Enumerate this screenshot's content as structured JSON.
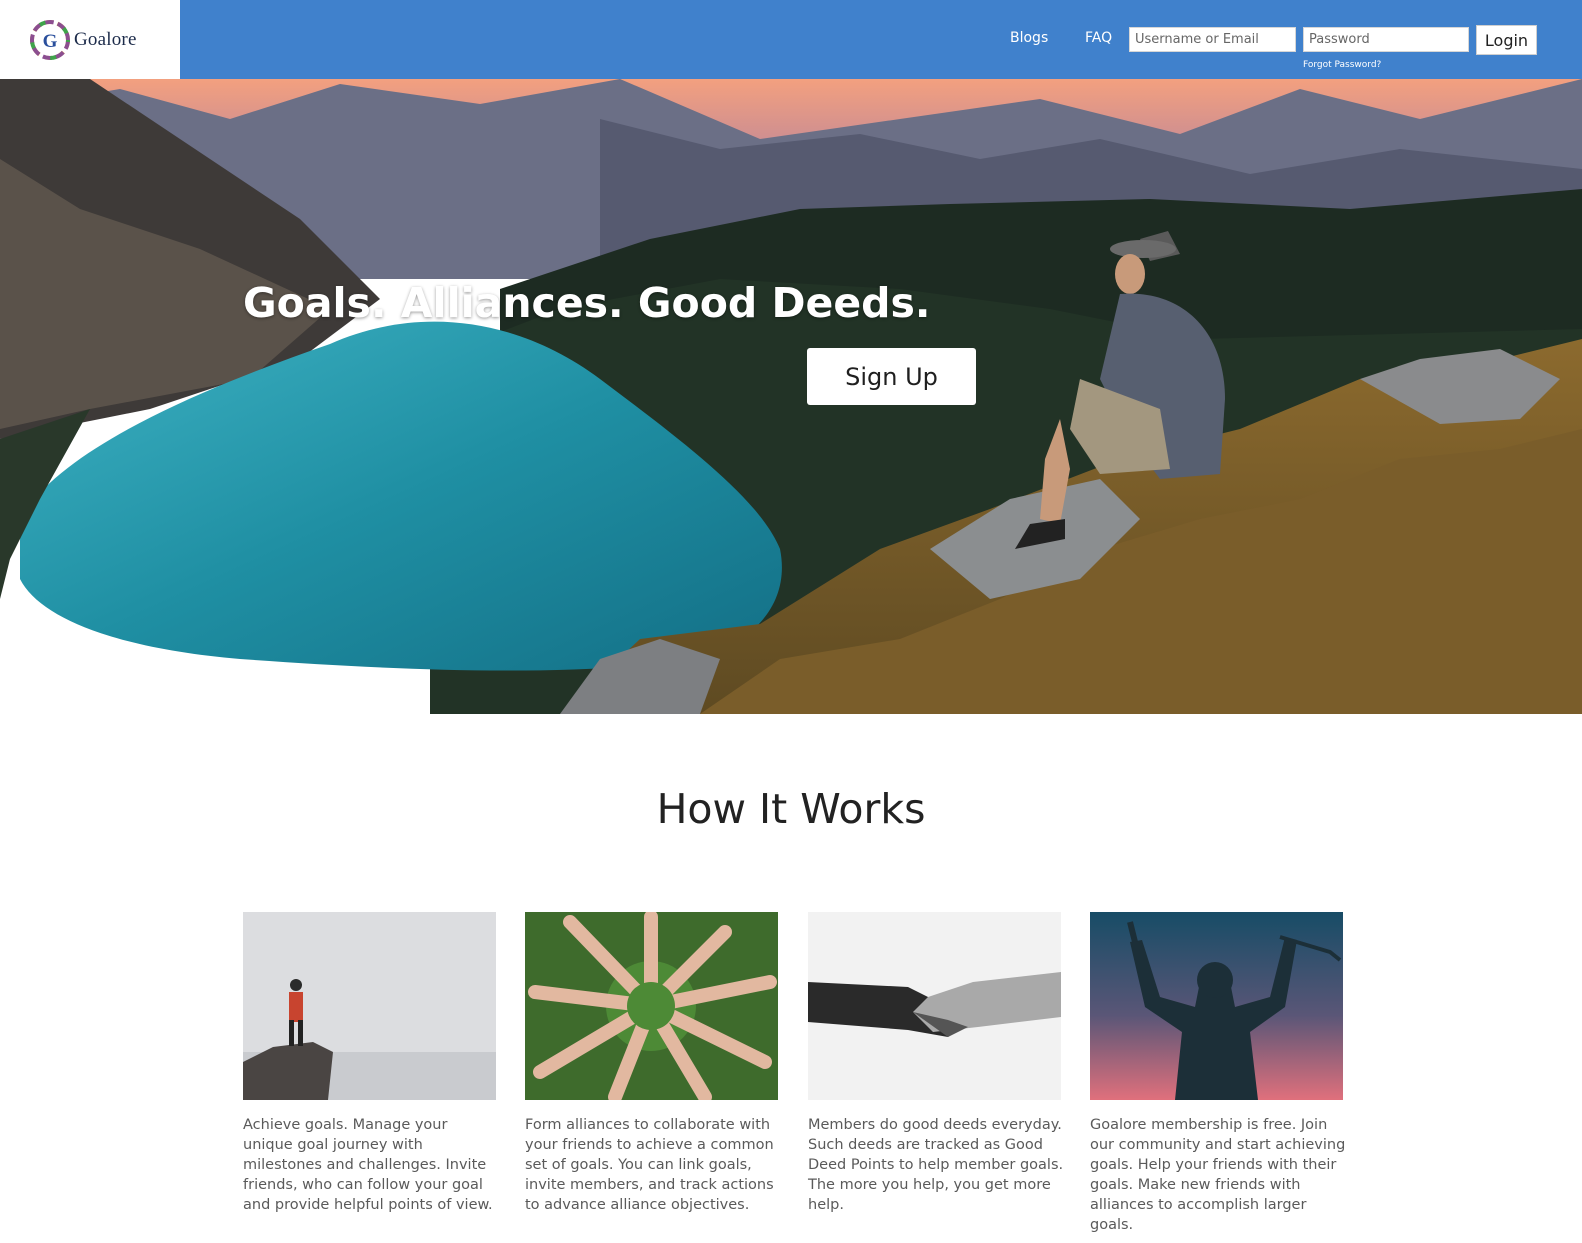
{
  "brand": {
    "name": "Goalore"
  },
  "nav": {
    "blogs": "Blogs",
    "faq": "FAQ"
  },
  "login": {
    "username_placeholder": "Username or Email",
    "password_placeholder": "Password",
    "button": "Login",
    "forgot": "Forgot Password?"
  },
  "hero": {
    "headline": "Goals. Alliances. Good Deeds.",
    "cta": "Sign Up"
  },
  "how_it_works": {
    "title": "How It Works",
    "cards": [
      {
        "image": "hiker-on-cliff",
        "text": "Achieve goals. Manage your unique goal journey with milestones and challenges. Invite friends, who can follow your goal and provide helpful points of view."
      },
      {
        "image": "hands-in-circle",
        "text": "Form alliances to collaborate with your friends to achieve a common set of goals. You can link goals, invite members, and track actions to advance alliance objectives."
      },
      {
        "image": "handshake",
        "text": "Members do good deeds everyday. Such deeds are tracked as Good Deed Points to help member goals. The more you help, you get more help."
      },
      {
        "image": "silhouette-celebrating",
        "text": "Goalore membership is free. Join our community and start achieving goals. Help your friends with their goals. Make new friends with alliances to accomplish larger goals."
      }
    ]
  },
  "colors": {
    "header": "#4081cc",
    "lake": "#1f8fa3",
    "text": "#5a5a5a"
  }
}
